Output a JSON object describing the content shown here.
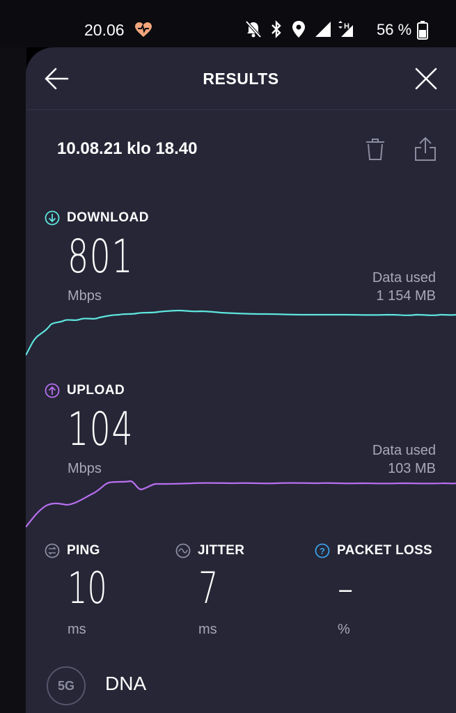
{
  "status_bar": {
    "time": "20.06",
    "battery": "56 %",
    "icons": [
      "heart-rate-icon",
      "bell-off-icon",
      "bluetooth-icon",
      "location-icon",
      "signal-icon",
      "data-hplus-icon",
      "signal-icon",
      "battery-icon"
    ]
  },
  "header": {
    "title": "RESULTS"
  },
  "result": {
    "date": "10.08.21 klo 18.40"
  },
  "download": {
    "label": "DOWNLOAD",
    "value": "801",
    "unit": "Mbps",
    "data_used_label": "Data used",
    "data_used_value": "1 154 MB",
    "color": "#5ee6de"
  },
  "upload": {
    "label": "UPLOAD",
    "value": "104",
    "unit": "Mbps",
    "data_used_label": "Data used",
    "data_used_value": "103 MB",
    "color": "#b86ff0"
  },
  "ping": {
    "label": "PING",
    "value": "10",
    "unit": "ms"
  },
  "jitter": {
    "label": "JITTER",
    "value": "7",
    "unit": "ms"
  },
  "packet_loss": {
    "label": "PACKET LOSS",
    "value": "–",
    "unit": "%",
    "icon_color": "#3aa0e6"
  },
  "provider": {
    "badge": "5G",
    "name": "DNA"
  },
  "colors": {
    "panel_background": "#262637",
    "accent_download": "#5ee6de",
    "accent_upload": "#b86ff0",
    "accent_info": "#3aa0e6"
  }
}
